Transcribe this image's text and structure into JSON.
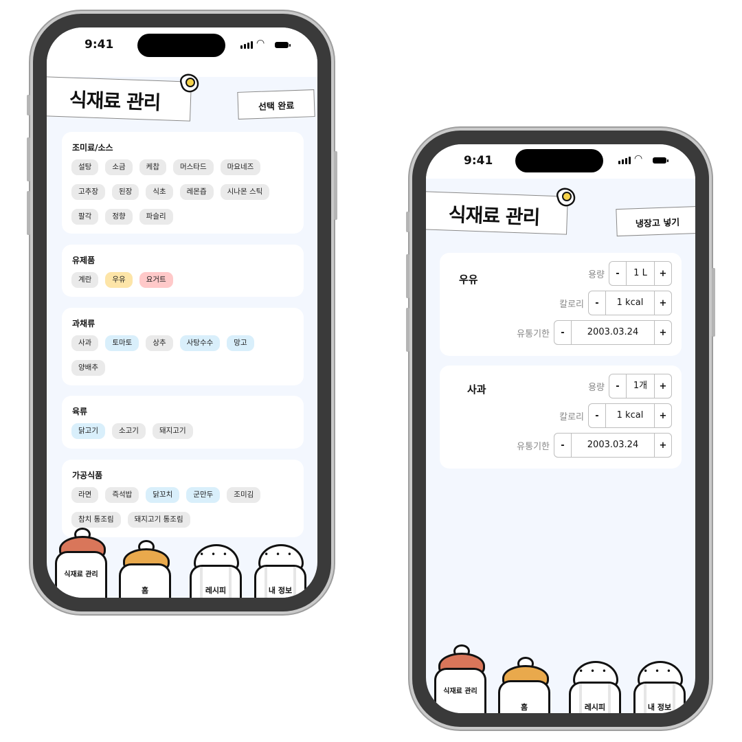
{
  "left_phone": {
    "status": {
      "time": "9:41"
    },
    "title": "식재료 관리",
    "action_button": "선택 완료",
    "categories": [
      {
        "title": "조미료/소스",
        "chips": [
          {
            "label": "설탕",
            "state": ""
          },
          {
            "label": "소금",
            "state": ""
          },
          {
            "label": "케찹",
            "state": ""
          },
          {
            "label": "머스타드",
            "state": ""
          },
          {
            "label": "마요네즈",
            "state": ""
          },
          {
            "label": "고추장",
            "state": ""
          },
          {
            "label": "된장",
            "state": ""
          },
          {
            "label": "식초",
            "state": ""
          },
          {
            "label": "레몬즙",
            "state": ""
          },
          {
            "label": "시나몬 스틱",
            "state": ""
          },
          {
            "label": "팔각",
            "state": ""
          },
          {
            "label": "정향",
            "state": ""
          },
          {
            "label": "파슬리",
            "state": ""
          }
        ]
      },
      {
        "title": "유제품",
        "chips": [
          {
            "label": "계란",
            "state": ""
          },
          {
            "label": "우유",
            "state": "yellow"
          },
          {
            "label": "요거트",
            "state": "red"
          }
        ]
      },
      {
        "title": "과채류",
        "chips": [
          {
            "label": "사과",
            "state": ""
          },
          {
            "label": "토마토",
            "state": "blue"
          },
          {
            "label": "상추",
            "state": ""
          },
          {
            "label": "사탕수수",
            "state": "blue"
          },
          {
            "label": "망고",
            "state": "blue"
          },
          {
            "label": "양배추",
            "state": ""
          }
        ]
      },
      {
        "title": "육류",
        "chips": [
          {
            "label": "닭고기",
            "state": "blue"
          },
          {
            "label": "소고기",
            "state": ""
          },
          {
            "label": "돼지고기",
            "state": ""
          }
        ]
      },
      {
        "title": "가공식품",
        "chips": [
          {
            "label": "라면",
            "state": ""
          },
          {
            "label": "즉석밥",
            "state": ""
          },
          {
            "label": "닭꼬치",
            "state": "blue"
          },
          {
            "label": "군만두",
            "state": "blue"
          },
          {
            "label": "조미김",
            "state": ""
          },
          {
            "label": "참치 통조림",
            "state": ""
          },
          {
            "label": "돼지고기 통조림",
            "state": ""
          }
        ]
      }
    ],
    "nav": [
      "식재료 관리",
      "홈",
      "레시피",
      "내 정보"
    ]
  },
  "right_phone": {
    "status": {
      "time": "9:41"
    },
    "title": "식재료 관리",
    "action_button": "냉장고 넣기",
    "items": [
      {
        "name": "우유",
        "fields": [
          {
            "label": "용량",
            "value": "1 L"
          },
          {
            "label": "칼로리",
            "value": "1 kcal"
          },
          {
            "label": "유통기한",
            "value": "2003.03.24"
          }
        ]
      },
      {
        "name": "사과",
        "fields": [
          {
            "label": "용량",
            "value": "1개"
          },
          {
            "label": "칼로리",
            "value": "1 kcal"
          },
          {
            "label": "유통기한",
            "value": "2003.03.24"
          }
        ]
      }
    ],
    "stepper": {
      "minus": "-",
      "plus": "+"
    },
    "nav": [
      "식재료 관리",
      "홈",
      "레시피",
      "내 정보"
    ]
  },
  "colors": {
    "jar_active": "#d9765a",
    "jar_home": "#e9a94c",
    "chip_blue": "#d9effb",
    "chip_yellow": "#fde5a8",
    "chip_red": "#ffc9c9",
    "screen_bg": "#f3f7fe"
  },
  "icons": [
    "fried-egg-icon",
    "signal-icon",
    "wifi-icon",
    "battery-icon",
    "jar-icon",
    "shaker-icon"
  ]
}
